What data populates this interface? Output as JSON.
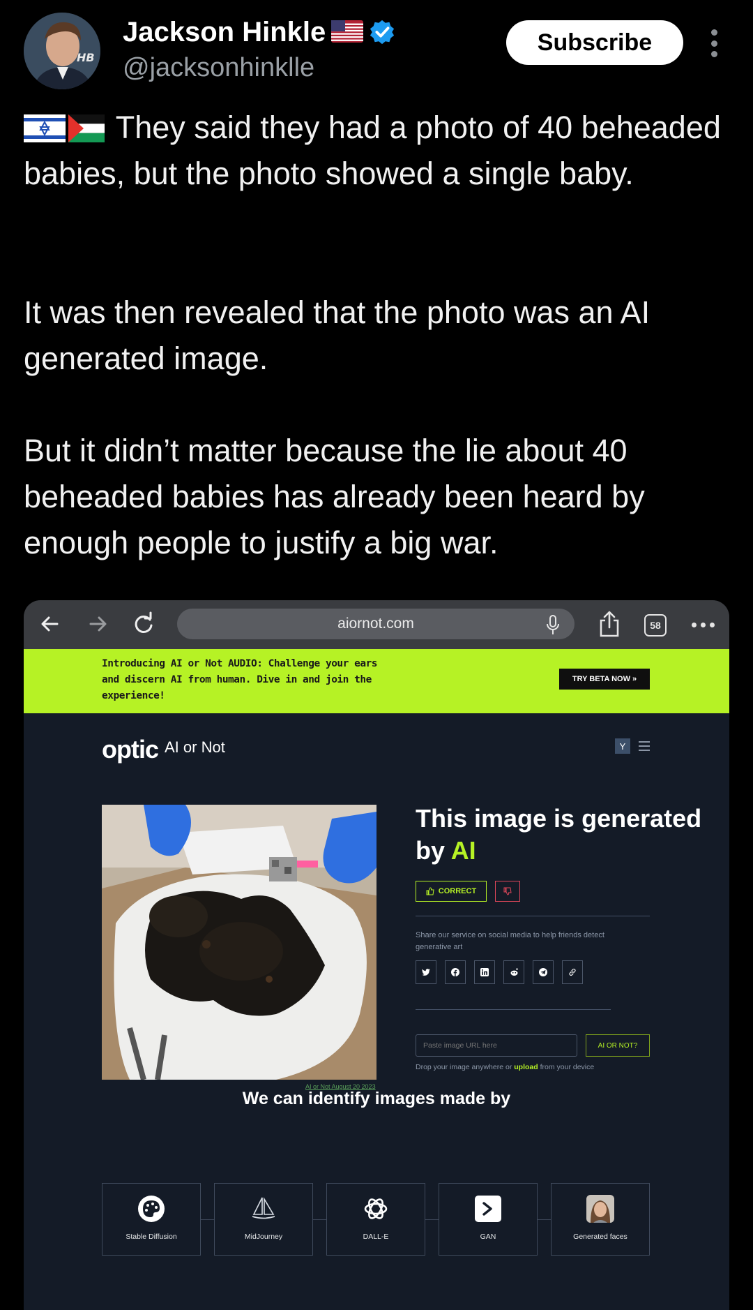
{
  "tweet": {
    "author_name": "Jackson Hinkle",
    "author_flag": "🇺🇸",
    "handle": "@jacksonhinklle",
    "subscribe_label": "Subscribe",
    "flags": [
      "🇮🇱",
      "🇵🇸"
    ],
    "paragraph1": "They said they had a photo of 40 beheaded babies, but the photo showed a single baby.",
    "paragraph2": "It was then revealed that the photo was an AI generated image.",
    "paragraph3": "But it didn’t matter because the lie about 40 beheaded babies has already been heard by enough people to justify a big war."
  },
  "browser": {
    "url": "aiornot.com",
    "tab_count": "58"
  },
  "site": {
    "banner_text": "Introducing AI or Not AUDIO: Challenge your ears and discern AI from human. Dive in and join the experience!",
    "banner_button": "TRY BETA NOW »",
    "logo": "optic",
    "logo_subtitle": "AI or Not",
    "user_badge": "Y",
    "photo_caption": "AI or Not August 20 2023",
    "result_title_prefix": "This image is generated by",
    "result_title_accent": "AI",
    "correct_label": "CORRECT",
    "share_text": "Share our service on social media to help friends detect generative art",
    "social_icons": [
      "twitter-icon",
      "facebook-icon",
      "linkedin-icon",
      "reddit-icon",
      "telegram-icon",
      "link-icon"
    ],
    "url_placeholder": "Paste image URL here",
    "ai_or_not_button": "AI OR NOT?",
    "drop_text_prefix": "Drop your image anywhere or",
    "drop_text_link": "upload",
    "drop_text_suffix": "from your device",
    "identify_title": "We can identify images made by",
    "models": [
      {
        "label": "Stable Diffusion",
        "icon": "palette-icon"
      },
      {
        "label": "MidJourney",
        "icon": "sailboat-icon"
      },
      {
        "label": "DALL-E",
        "icon": "openai-icon"
      },
      {
        "label": "GAN",
        "icon": "terminal-icon"
      },
      {
        "label": "Generated faces",
        "icon": "face-icon"
      }
    ]
  },
  "colors": {
    "accent": "#b6f225",
    "verified": "#1d9bf0",
    "site_bg": "#141b27"
  }
}
